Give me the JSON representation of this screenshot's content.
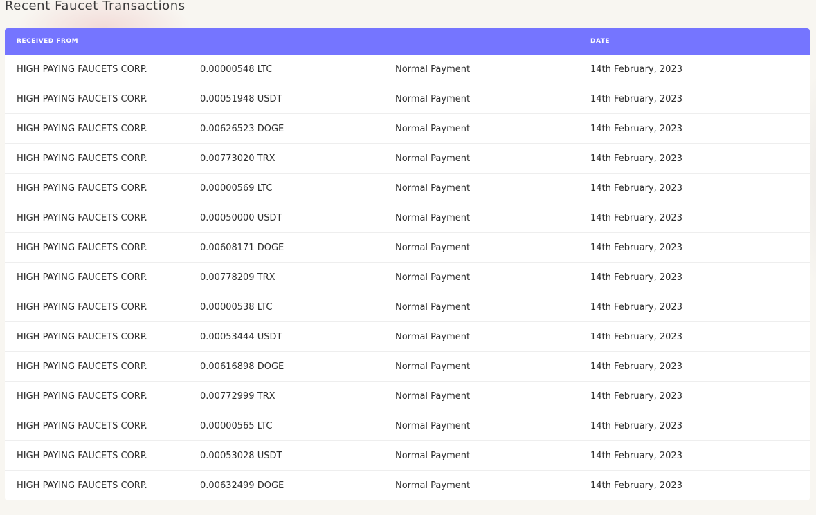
{
  "page": {
    "title": "Recent Faucet Transactions"
  },
  "table": {
    "columns": [
      "RECEIVED FROM",
      "",
      "",
      "DATE"
    ],
    "rows": [
      {
        "from": "HIGH PAYING FAUCETS CORP.",
        "amount": "0.00000548 LTC",
        "type": "Normal Payment",
        "date": "14th February, 2023"
      },
      {
        "from": "HIGH PAYING FAUCETS CORP.",
        "amount": "0.00051948 USDT",
        "type": "Normal Payment",
        "date": "14th February, 2023"
      },
      {
        "from": "HIGH PAYING FAUCETS CORP.",
        "amount": "0.00626523 DOGE",
        "type": "Normal Payment",
        "date": "14th February, 2023"
      },
      {
        "from": "HIGH PAYING FAUCETS CORP.",
        "amount": "0.00773020 TRX",
        "type": "Normal Payment",
        "date": "14th February, 2023"
      },
      {
        "from": "HIGH PAYING FAUCETS CORP.",
        "amount": "0.00000569 LTC",
        "type": "Normal Payment",
        "date": "14th February, 2023"
      },
      {
        "from": "HIGH PAYING FAUCETS CORP.",
        "amount": "0.00050000 USDT",
        "type": "Normal Payment",
        "date": "14th February, 2023"
      },
      {
        "from": "HIGH PAYING FAUCETS CORP.",
        "amount": "0.00608171 DOGE",
        "type": "Normal Payment",
        "date": "14th February, 2023"
      },
      {
        "from": "HIGH PAYING FAUCETS CORP.",
        "amount": "0.00778209 TRX",
        "type": "Normal Payment",
        "date": "14th February, 2023"
      },
      {
        "from": "HIGH PAYING FAUCETS CORP.",
        "amount": "0.00000538 LTC",
        "type": "Normal Payment",
        "date": "14th February, 2023"
      },
      {
        "from": "HIGH PAYING FAUCETS CORP.",
        "amount": "0.00053444 USDT",
        "type": "Normal Payment",
        "date": "14th February, 2023"
      },
      {
        "from": "HIGH PAYING FAUCETS CORP.",
        "amount": "0.00616898 DOGE",
        "type": "Normal Payment",
        "date": "14th February, 2023"
      },
      {
        "from": "HIGH PAYING FAUCETS CORP.",
        "amount": "0.00772999 TRX",
        "type": "Normal Payment",
        "date": "14th February, 2023"
      },
      {
        "from": "HIGH PAYING FAUCETS CORP.",
        "amount": "0.00000565 LTC",
        "type": "Normal Payment",
        "date": "14th February, 2023"
      },
      {
        "from": "HIGH PAYING FAUCETS CORP.",
        "amount": "0.00053028 USDT",
        "type": "Normal Payment",
        "date": "14th February, 2023"
      },
      {
        "from": "HIGH PAYING FAUCETS CORP.",
        "amount": "0.00632499 DOGE",
        "type": "Normal Payment",
        "date": "14th February, 2023"
      }
    ]
  },
  "colors": {
    "header_bg": "#7575ff",
    "page_bg": "#f8f6f1"
  }
}
